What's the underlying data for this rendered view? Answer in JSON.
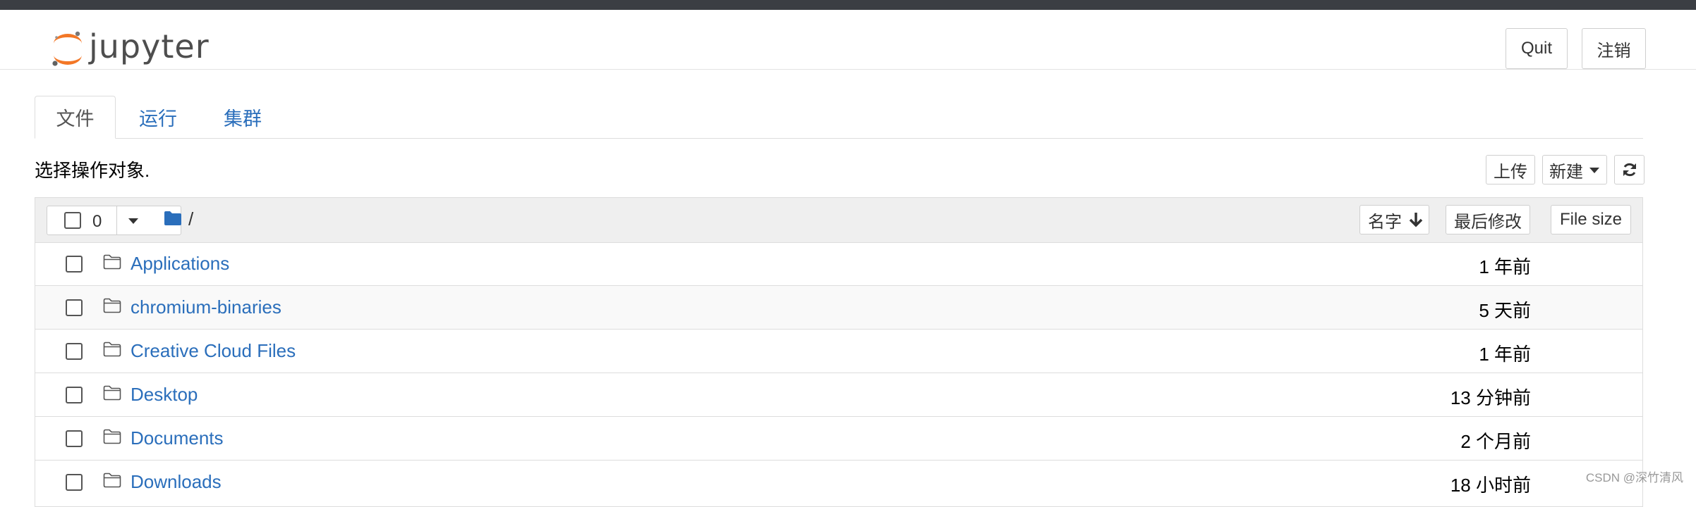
{
  "app": {
    "logo_text": "jupyter"
  },
  "header": {
    "quit_label": "Quit",
    "logout_label": "注销"
  },
  "tabs": [
    {
      "label": "文件",
      "active": true
    },
    {
      "label": "运行",
      "active": false
    },
    {
      "label": "集群",
      "active": false
    }
  ],
  "toolbar": {
    "instruction": "选择操作对象.",
    "upload_label": "上传",
    "new_label": "新建",
    "refresh_icon": "refresh-icon"
  },
  "list_header": {
    "selected_count": "0",
    "path": "/",
    "sort_name_label": "名字",
    "sort_modified_label": "最后修改",
    "sort_size_label": "File size"
  },
  "files": [
    {
      "name": "Applications",
      "modified": "1 年前"
    },
    {
      "name": "chromium-binaries",
      "modified": "5 天前"
    },
    {
      "name": "Creative Cloud Files",
      "modified": "1 年前"
    },
    {
      "name": "Desktop",
      "modified": "13 分钟前"
    },
    {
      "name": "Documents",
      "modified": "2 个月前"
    },
    {
      "name": "Downloads",
      "modified": "18 小时前"
    }
  ],
  "watermark": "CSDN @深竹清风",
  "colors": {
    "link": "#2a6ebb",
    "topbar": "#3b3e43",
    "logo_orange": "#f37726"
  }
}
